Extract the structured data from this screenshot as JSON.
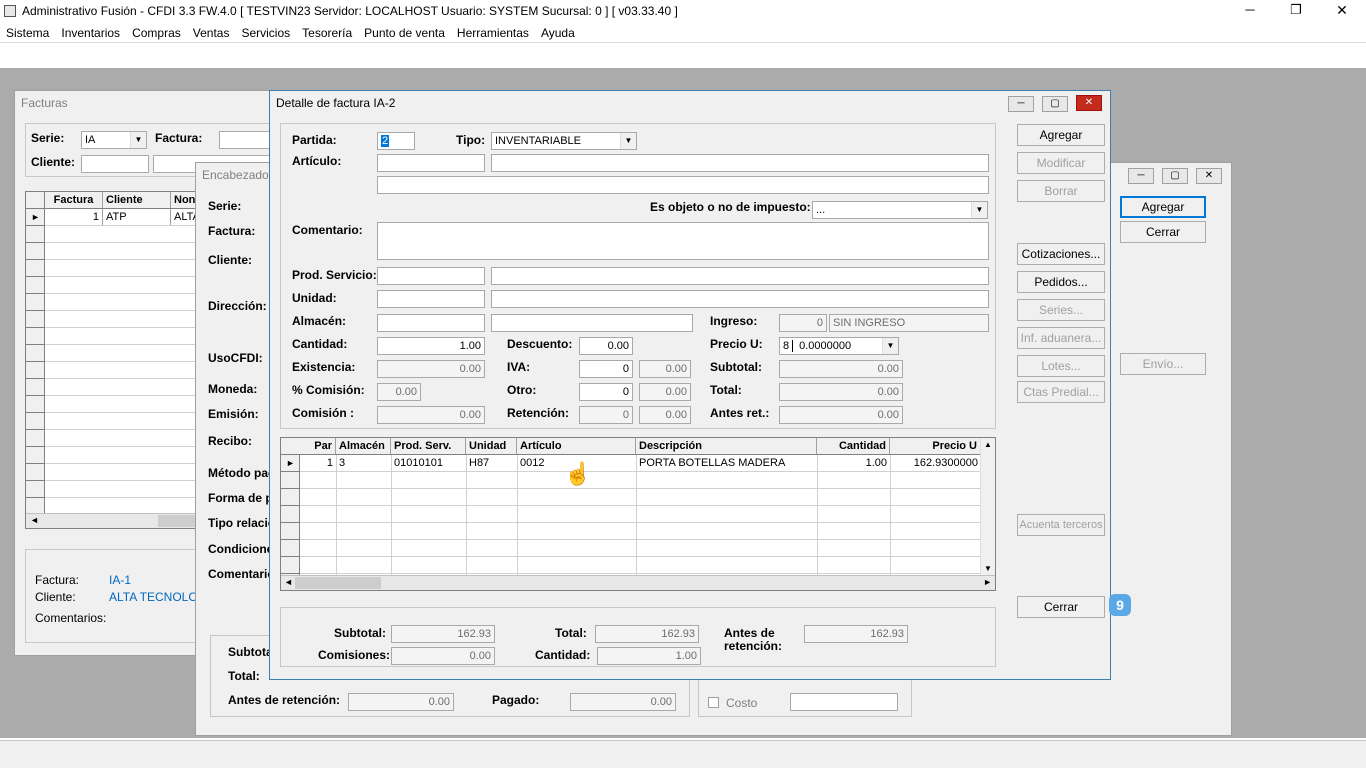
{
  "app": {
    "title": "Administrativo Fusión - CFDI 3.3 FW.4.0 [ TESTVIN23  Servidor: LOCALHOST   Usuario: SYSTEM    Sucursal: 0 ] [ v03.33.40 ]",
    "minimize": "─",
    "restore": "❐",
    "close": "✕"
  },
  "menu": [
    "Sistema",
    "Inventarios",
    "Compras",
    "Ventas",
    "Servicios",
    "Tesorería",
    "Punto de venta",
    "Herramientas",
    "Ayuda"
  ],
  "facturas": {
    "title": "Facturas",
    "serie_label": "Serie:",
    "serie_value": "IA",
    "factura_label": "Factura:",
    "cliente_label": "Cliente:",
    "grid_headers": [
      "Factura",
      "Cliente",
      "Non"
    ],
    "row": {
      "factura": "1",
      "cliente": "ATP",
      "nombre": "ALTA"
    },
    "info": {
      "factura_label": "Factura:",
      "factura_value": "IA-1",
      "cliente_label": "Cliente:",
      "cliente_value": "ALTA TECNOLOGI",
      "comentarios_label": "Comentarios:"
    }
  },
  "encabezado": {
    "title": "Encabezado",
    "labels": [
      "Serie:",
      "Factura:",
      "Cliente:",
      "Dirección:",
      "UsoCFDI:",
      "Moneda:",
      "Emisión:",
      "Recibo:",
      "Método pag",
      "Forma de p",
      "Tipo relació",
      "Condicione",
      "Comentario"
    ],
    "subtotal_label": "Subtota",
    "total_label": "Total:",
    "antes_label": "Antes de retención:",
    "antes_value": "0.00",
    "pagado_label": "Pagado:",
    "pagado_value": "0.00",
    "costo_label": "Costo"
  },
  "outer_buttons": {
    "agregar": "Agregar",
    "cerrar": "Cerrar",
    "envio": "Envío..."
  },
  "detalle": {
    "title": "Detalle de factura IA-2",
    "partida_label": "Partida:",
    "partida_value": "2",
    "tipo_label": "Tipo:",
    "tipo_value": "INVENTARIABLE",
    "articulo_label": "Artículo:",
    "objeto_label": "Es objeto o no de impuesto:",
    "objeto_value": "...",
    "comentario_label": "Comentario:",
    "prod_label": "Prod. Servicio:",
    "unidad_label": "Unidad:",
    "almacen_label": "Almacén:",
    "ingreso_label": "Ingreso:",
    "ingreso_value": "0",
    "ingreso_text": "SIN INGRESO",
    "cantidad_label": "Cantidad:",
    "cantidad_value": "1.00",
    "descuento_label": "Descuento:",
    "descuento_value": "0.00",
    "precio_label": "Precio U:",
    "precio_prefix": "8",
    "precio_value": "0.0000000",
    "existencia_label": "Existencia:",
    "existencia_value": "0.00",
    "iva_label": "IVA:",
    "iva_value": "0",
    "iva_amount": "0.00",
    "subtotal_label": "Subtotal:",
    "subtotal_value": "0.00",
    "comision_pct_label": "% Comisión:",
    "comision_pct_value": "0.00",
    "otro_label": "Otro:",
    "otro_value": "0",
    "otro_amount": "0.00",
    "total_label": "Total:",
    "total_value": "0.00",
    "comision_label": "Comisión :",
    "comision_value": "0.00",
    "retencion_label": "Retención:",
    "retencion_value": "0",
    "retencion_amount": "0.00",
    "antes_label": "Antes ret.:",
    "antes_value": "0.00",
    "grid": {
      "headers": [
        "Par",
        "Almacén",
        "Prod. Serv.",
        "Unidad",
        "Artículo",
        "Descripción",
        "Cantidad",
        "Precio U"
      ],
      "row": {
        "par": "1",
        "almacen": "3",
        "prod": "01010101",
        "unidad": "H87",
        "articulo": "0012",
        "descripcion": "PORTA BOTELLAS MADERA",
        "cantidad": "1.00",
        "precio": "162.9300000"
      }
    },
    "footer": {
      "subtotal_label": "Subtotal:",
      "subtotal_value": "162.93",
      "total_label": "Total:",
      "total_value": "162.93",
      "antes_label_1": "Antes de",
      "antes_label_2": "retención:",
      "antes_value": "162.93",
      "comisiones_label": "Comisiones:",
      "comisiones_value": "0.00",
      "cantidad_label": "Cantidad:",
      "cantidad_value": "1.00"
    },
    "buttons": {
      "agregar": "Agregar",
      "modificar": "Modificar",
      "borrar": "Borrar",
      "cotizaciones": "Cotizaciones...",
      "pedidos": "Pedidos...",
      "series": "Series...",
      "aduanera": "Inf. aduanera...",
      "lotes": "Lotes...",
      "predial": "Ctas Predial...",
      "terceros": "Acuenta terceros",
      "cerrar": "Cerrar"
    },
    "badge": "9"
  }
}
